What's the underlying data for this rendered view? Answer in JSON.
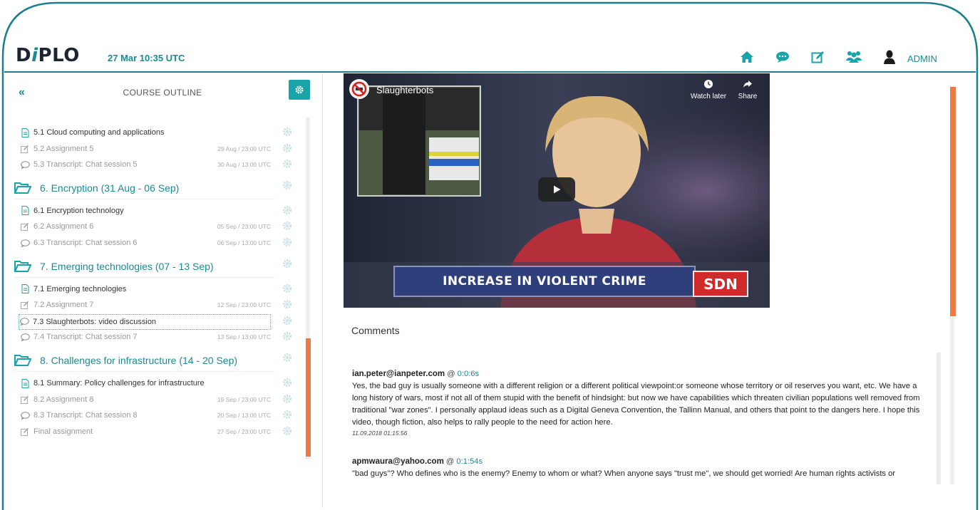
{
  "header": {
    "logo": {
      "pre": "D",
      "italic": "i",
      "post": "PLO"
    },
    "datetime": "27 Mar 10:35 UTC",
    "admin_label": "ADMIN",
    "nav_icons": [
      "home-icon",
      "chat-icon",
      "edit-icon",
      "group-icon",
      "user-icon"
    ],
    "accent_color": "#1a8a94"
  },
  "sidebar": {
    "back_label": "«",
    "title": "COURSE OUTLINE",
    "items": [
      {
        "type": "item",
        "icon": "document-icon",
        "label": "5.1 Cloud computing and applications",
        "due": "",
        "muted": false
      },
      {
        "type": "item",
        "icon": "edit-icon",
        "label": "5.2 Assignment 5",
        "due": "29 Aug / 23:00 UTC",
        "muted": true
      },
      {
        "type": "item",
        "icon": "chat-icon",
        "label": "5.3 Transcript: Chat session 5",
        "due": "30 Aug / 13:00 UTC",
        "muted": true
      },
      {
        "type": "section",
        "label": "6. Encryption (31 Aug - 06 Sep)"
      },
      {
        "type": "item",
        "icon": "document-icon",
        "label": "6.1 Encryption technology",
        "due": "",
        "muted": false
      },
      {
        "type": "item",
        "icon": "edit-icon",
        "label": "6.2 Assignment 6",
        "due": "05 Sep / 23:00 UTC",
        "muted": true
      },
      {
        "type": "item",
        "icon": "chat-icon",
        "label": "6.3 Transcript: Chat session 6",
        "due": "06 Sep / 13:00 UTC",
        "muted": true
      },
      {
        "type": "section",
        "label": "7. Emerging technologies (07 - 13 Sep)"
      },
      {
        "type": "item",
        "icon": "document-icon",
        "label": "7.1 Emerging technologies",
        "due": "",
        "muted": false
      },
      {
        "type": "item",
        "icon": "edit-icon",
        "label": "7.2 Assignment 7",
        "due": "12 Sep / 23:00 UTC",
        "muted": true
      },
      {
        "type": "item",
        "icon": "chat-icon",
        "label": "7.3 Slaughterbots: video discussion",
        "due": "",
        "muted": false,
        "highlight": true
      },
      {
        "type": "item",
        "icon": "chat-icon",
        "label": "7.4 Transcript: Chat session 7",
        "due": "13 Sep / 13:00 UTC",
        "muted": true
      },
      {
        "type": "section",
        "label": "8. Challenges for infrastructure (14 - 20 Sep)"
      },
      {
        "type": "item",
        "icon": "document-icon",
        "label": "8.1 Summary: Policy challenges for infrastructure",
        "due": "",
        "muted": false
      },
      {
        "type": "item",
        "icon": "edit-icon",
        "label": "8.2 Assignment 8",
        "due": "19 Sep / 23:00 UTC",
        "muted": true
      },
      {
        "type": "item",
        "icon": "chat-icon",
        "label": "8.3 Transcript: Chat session 8",
        "due": "20 Sep / 13:00 UTC",
        "muted": true
      },
      {
        "type": "item",
        "icon": "edit-icon",
        "label": "Final assignment",
        "due": "27 Sep / 23:00 UTC",
        "muted": true
      }
    ]
  },
  "video": {
    "title": "Slaughterbots",
    "watch_later": "Watch later",
    "share": "Share",
    "lower_third": "INCREASE IN VIOLENT CRIME",
    "network": "SDN"
  },
  "comments": {
    "title": "Comments",
    "list": [
      {
        "author": "ian.peter@ianpeter.com",
        "at": " @ ",
        "timestamp": "0:0:6s",
        "text": "Yes, the bad guy is usually someone with a different religion or a different political viewpoint:or someone whose territory or oil reserves you want, etc. We have a long history of wars, most if not all of them stupid with the benefit of hindsight: but now we have capabilities which threaten civilian populations well removed from traditional \"war zones\". I personally applaud ideas such as a Digital Geneva Convention, the Tallinn Manual, and others that point to the dangers here. I hope this video, though fiction, also helps to rally people to the need for action here.",
        "date": "11.09.2018 01:15:56"
      },
      {
        "author": "apmwaura@yahoo.com",
        "at": " @ ",
        "timestamp": "0:1:54s",
        "text": "\"bad guys\"? Who defines who is the enemy? Enemy to whom or what? When anyone says \"trust me\", we should get worried! Are human rights activists or",
        "date": ""
      }
    ]
  }
}
